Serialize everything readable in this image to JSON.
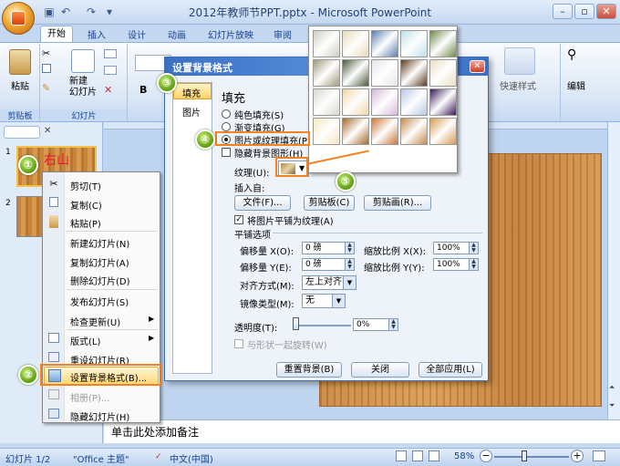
{
  "window": {
    "title": "2012年教师节PPT.pptx - Microsoft PowerPoint",
    "min_icon": "minimize-icon",
    "max_icon": "maximize-icon",
    "close_icon": "close-icon"
  },
  "ribbon_tabs": [
    "开始",
    "插入",
    "设计",
    "动画",
    "幻灯片放映",
    "审阅"
  ],
  "ribbon": {
    "paste_label": "粘贴",
    "new_slide_label": "新建\n幻灯片",
    "clipboard_group": "剪贴板",
    "slides_group": "幻灯片",
    "quick_styles_label": "快速样式",
    "editing_label": "编辑",
    "bold_label": "B"
  },
  "slide_pane": {
    "slide1_number": "1",
    "slide2_number": "2",
    "slide1_text": "右山"
  },
  "context_menu": {
    "items": [
      {
        "label": "剪切(T)",
        "icon": "scissors-icon"
      },
      {
        "label": "复制(C)",
        "icon": "copy-icon"
      },
      {
        "label": "粘贴(P)",
        "icon": "paste-icon"
      },
      {
        "label": "新建幻灯片(N)",
        "icon": ""
      },
      {
        "label": "复制幻灯片(A)",
        "icon": ""
      },
      {
        "label": "删除幻灯片(D)",
        "icon": ""
      },
      {
        "label": "发布幻灯片(S)",
        "icon": ""
      },
      {
        "label": "检查更新(U)",
        "icon": ""
      },
      {
        "label": "版式(L)",
        "icon": "layout-icon"
      },
      {
        "label": "重设幻灯片(R)",
        "icon": "reset-icon"
      },
      {
        "label": "设置背景格式(B)...",
        "icon": "format-background-icon"
      },
      {
        "label": "相册(P)...",
        "icon": "photo-album-icon"
      },
      {
        "label": "隐藏幻灯片(H)",
        "icon": "hide-slide-icon"
      }
    ]
  },
  "dialog": {
    "title": "设置背景格式",
    "nav_fill": "填充",
    "nav_picture": "图片",
    "section_title": "填充",
    "radio_solid": "纯色填充(S)",
    "radio_gradient": "渐变填充(G)",
    "radio_picture": "图片或纹理填充(P)",
    "check_hide_bg": "隐藏背景图形(H)",
    "texture_label": "纹理(U):",
    "insert_from": "插入自:",
    "btn_file": "文件(F)...",
    "btn_clipboard": "剪贴板(C)",
    "btn_clipart": "剪贴画(R)...",
    "tile_check": "将图片平铺为纹理(A)",
    "tiling_options": "平铺选项",
    "offset_x_label": "偏移量 X(O):",
    "offset_x_value": "0 磅",
    "offset_y_label": "偏移量 Y(E):",
    "offset_y_value": "0 磅",
    "scale_x_label": "缩放比例 X(X):",
    "scale_x_value": "100%",
    "scale_y_label": "缩放比例 Y(Y):",
    "scale_y_value": "100%",
    "align_label": "对齐方式(M):",
    "align_value": "左上对齐",
    "mirror_label": "镜像类型(M):",
    "mirror_value": "无",
    "transparency_label": "透明度(T):",
    "transparency_value": "0%",
    "rotate_label": "与形状一起旋转(W)",
    "btn_reset": "重置背景(B)",
    "btn_close": "关闭",
    "btn_apply_all": "全部应用(L)"
  },
  "palette": {
    "textures": [
      "#cfcfbf",
      "#e8d9b8",
      "#5e7fb0",
      "#bde0ea",
      "#6e8a4a",
      "#a09a7c",
      "#4a5a3a",
      "#e6e6e6",
      "#5e3a1f",
      "#eaddc4",
      "#d7d7cf",
      "#f0d6a8",
      "#d6b7d9",
      "#b7c7e6",
      "#3a1a5a",
      "#f4e7c0",
      "#a46a2a",
      "#c8783a",
      "#c48a4a",
      "#d89a50"
    ]
  },
  "badges": [
    "①",
    "②",
    "③",
    "④",
    "⑤"
  ],
  "notes_placeholder": "单击此处添加备注",
  "status": {
    "slide_info": "幻灯片 1/2",
    "theme": "\"Office 主题\"",
    "language": "中文(中国)",
    "zoom": "58%"
  }
}
